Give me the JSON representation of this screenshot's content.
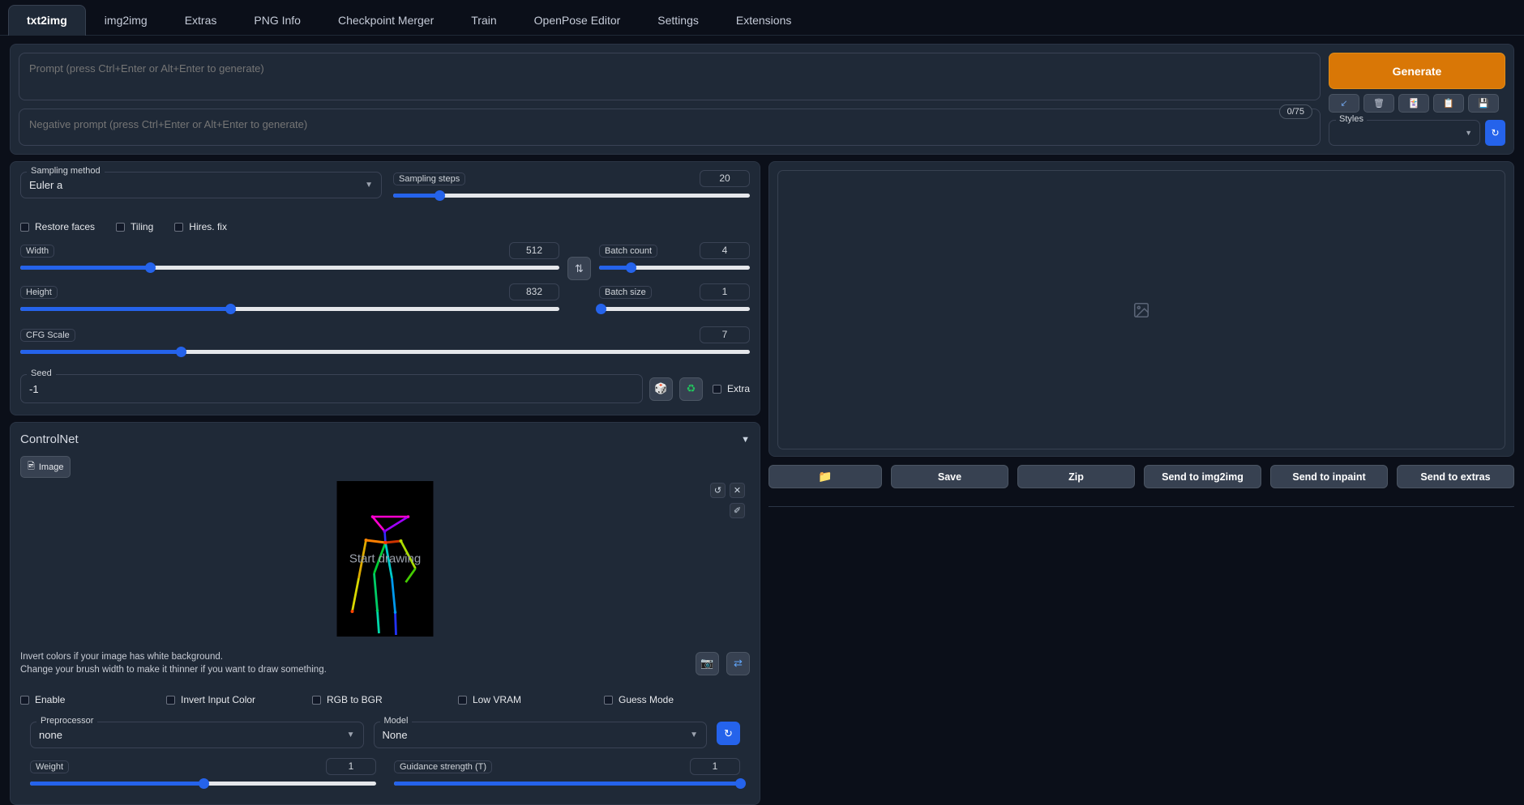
{
  "tabs": [
    {
      "label": "txt2img",
      "active": true
    },
    {
      "label": "img2img",
      "active": false
    },
    {
      "label": "Extras",
      "active": false
    },
    {
      "label": "PNG Info",
      "active": false
    },
    {
      "label": "Checkpoint Merger",
      "active": false
    },
    {
      "label": "Train",
      "active": false
    },
    {
      "label": "OpenPose Editor",
      "active": false
    },
    {
      "label": "Settings",
      "active": false
    },
    {
      "label": "Extensions",
      "active": false
    }
  ],
  "prompt": {
    "positive_value": "",
    "positive_placeholder": "Prompt (press Ctrl+Enter or Alt+Enter to generate)",
    "negative_value": "",
    "negative_placeholder": "Negative prompt (press Ctrl+Enter or Alt+Enter to generate)",
    "token_count": "0/75"
  },
  "generate": {
    "label": "Generate",
    "icons": [
      {
        "name": "arrow-down-left-icon",
        "glyph": "↙"
      },
      {
        "name": "trash-icon",
        "glyph": "🗑"
      },
      {
        "name": "paint-card-icon",
        "glyph": "🃏"
      },
      {
        "name": "clipboard-icon",
        "glyph": "📋"
      },
      {
        "name": "floppy-save-icon",
        "glyph": "💾"
      }
    ]
  },
  "styles": {
    "label": "Styles",
    "value": "",
    "refresh_glyph": "🔄"
  },
  "settings": {
    "sampling_method": {
      "label": "Sampling method",
      "value": "Euler a"
    },
    "sampling_steps": {
      "label": "Sampling steps",
      "value": "20",
      "percent": 13
    },
    "checkboxes": [
      {
        "label": "Restore faces",
        "checked": false
      },
      {
        "label": "Tiling",
        "checked": false
      },
      {
        "label": "Hires. fix",
        "checked": false
      }
    ],
    "width": {
      "label": "Width",
      "value": "512",
      "percent": 24
    },
    "height": {
      "label": "Height",
      "value": "832",
      "percent": 39
    },
    "cfg_scale": {
      "label": "CFG Scale",
      "value": "7",
      "percent": 22
    },
    "batch_count": {
      "label": "Batch count",
      "value": "4",
      "percent": 21
    },
    "batch_size": {
      "label": "Batch size",
      "value": "1",
      "percent": 0
    },
    "swap_glyph": "⇅",
    "seed": {
      "label": "Seed",
      "value": "-1"
    },
    "seed_random_glyph": "🎲",
    "seed_recycle_glyph": "♻",
    "extra_label": "Extra",
    "extra_checked": false
  },
  "controlnet": {
    "title": "ControlNet",
    "collapse_glyph": "▼",
    "image_tab_label": "Image",
    "image_tab_icon_glyph": "⛰",
    "canvas_placeholder": "Start drawing",
    "tools": [
      {
        "name": "undo-icon",
        "glyph": "↺"
      },
      {
        "name": "clear-icon",
        "glyph": "✕"
      },
      {
        "name": "brush-icon",
        "glyph": "✐"
      }
    ],
    "hint_line1": "Invert colors if your image has white background.",
    "hint_line2": "Change your brush width to make it thinner if you want to draw something.",
    "camera_glyph": "📷",
    "swap_glyph": "⇄",
    "checkboxes": [
      {
        "label": "Enable",
        "checked": false
      },
      {
        "label": "Invert Input Color",
        "checked": false
      },
      {
        "label": "RGB to BGR",
        "checked": false
      },
      {
        "label": "Low VRAM",
        "checked": false
      },
      {
        "label": "Guess Mode",
        "checked": false
      }
    ],
    "preprocessor": {
      "label": "Preprocessor",
      "value": "none"
    },
    "model": {
      "label": "Model",
      "value": "None"
    },
    "model_refresh_glyph": "🔄",
    "weight": {
      "label": "Weight",
      "value": "1",
      "percent": 50
    },
    "guidance_strength": {
      "label": "Guidance strength (T)",
      "value": "1",
      "percent": 100
    }
  },
  "output": {
    "placeholder_icon": "image-placeholder-icon",
    "buttons": [
      {
        "name": "open-folder-button",
        "label": "",
        "glyph": "📁"
      },
      {
        "name": "save-button",
        "label": "Save",
        "glyph": ""
      },
      {
        "name": "zip-button",
        "label": "Zip",
        "glyph": ""
      },
      {
        "name": "send-to-img2img-button",
        "label": "Send to img2img",
        "glyph": ""
      },
      {
        "name": "send-to-inpaint-button",
        "label": "Send to inpaint",
        "glyph": ""
      },
      {
        "name": "send-to-extras-button",
        "label": "Send to extras",
        "glyph": ""
      }
    ]
  },
  "colors": {
    "accent_orange": "#d97706",
    "slider_blue": "#2563eb",
    "panel_bg": "#1f2937",
    "page_bg": "#0b0f19"
  }
}
